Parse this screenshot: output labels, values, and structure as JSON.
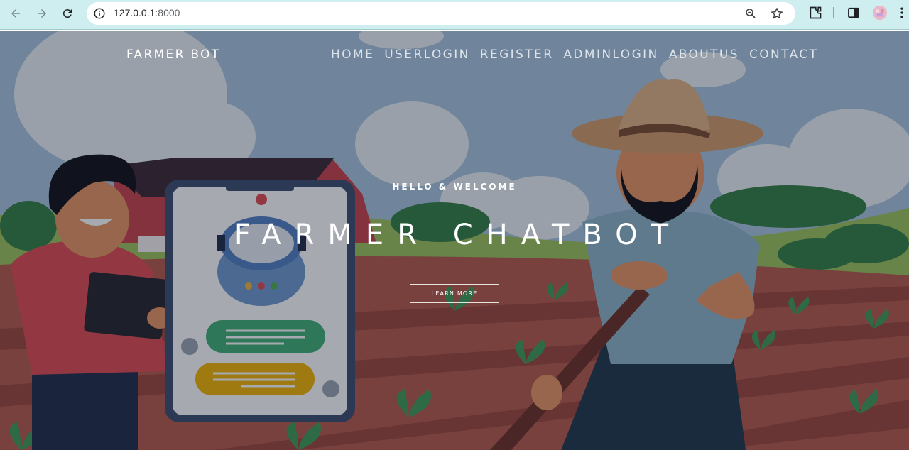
{
  "browser": {
    "url_host": "127.0.0.1",
    "url_port": ":8000"
  },
  "nav": {
    "brand": "FARMER BOT",
    "items": [
      {
        "label": "HOME"
      },
      {
        "label": "USERLOGIN"
      },
      {
        "label": "REGISTER"
      },
      {
        "label": "ADMINLOGIN"
      },
      {
        "label": "ABOUTUS"
      },
      {
        "label": "CONTACT"
      }
    ]
  },
  "hero": {
    "greeting": "HELLO & WELCOME",
    "title": "FARMER CHATBOT",
    "cta_label": "LEARN MORE"
  }
}
